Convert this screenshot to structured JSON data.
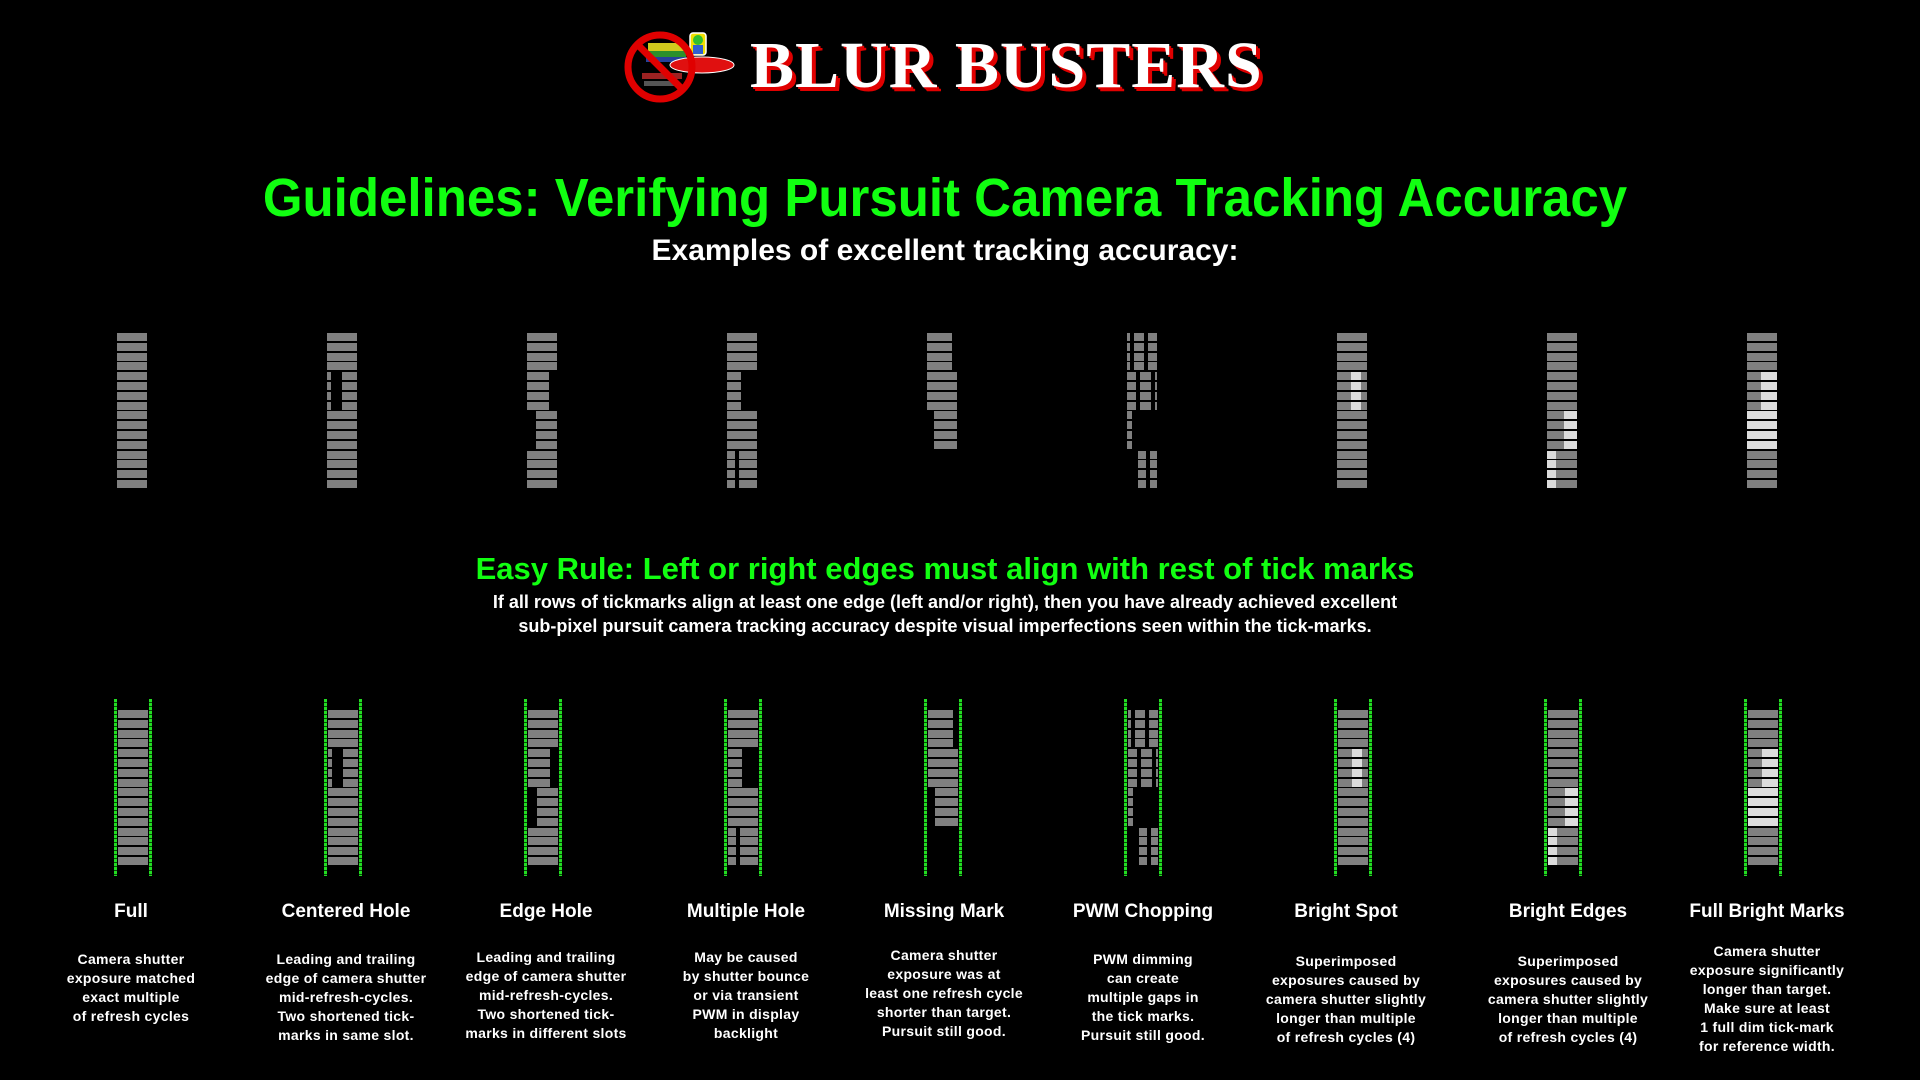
{
  "logo": {
    "text": "BLUR BUSTERS",
    "icon": "no-blur-ufo-icon"
  },
  "title": "Guidelines: Verifying Pursuit Camera Tracking Accuracy",
  "subtitle": "Examples of excellent tracking accuracy:",
  "rule": {
    "heading": "Easy Rule: Left or right edges must align with rest of tick marks",
    "lines": [
      "If all rows of tickmarks align at least one edge (left and/or right), then you have already achieved excellent",
      "sub-pixel pursuit camera tracking accuracy despite visual imperfections seen within the tick-marks."
    ]
  },
  "colors": {
    "title_green": "#11ff11",
    "tick_dim": "#808080",
    "tick_bright": "#dcdcdc",
    "guide_green": "#22dd22",
    "logo_red": "#e00000"
  },
  "tick_rows": 16,
  "tick_pattern_units": "segment ranges as fraction of full tick width [start, end, brightness]",
  "examples": [
    {
      "label": "Full",
      "description": [
        "Camera shutter",
        "exposure matched",
        "exact multiple",
        "of refresh cycles"
      ],
      "groups": [
        [
          [
            0,
            1,
            "dim"
          ]
        ],
        [
          [
            0,
            1,
            "dim"
          ]
        ],
        [
          [
            0,
            1,
            "dim"
          ]
        ],
        [
          [
            0,
            1,
            "dim"
          ]
        ]
      ]
    },
    {
      "label": "Centered Hole",
      "description": [
        "Leading and trailing",
        "edge of camera shutter",
        "mid-refresh-cycles.",
        "Two shortened tick-",
        "marks in same slot."
      ],
      "groups": [
        [
          [
            0,
            1,
            "dim"
          ]
        ],
        [
          [
            0,
            0.13,
            "dim"
          ],
          [
            0.5,
            1,
            "dim"
          ]
        ],
        [
          [
            0,
            1,
            "dim"
          ]
        ],
        [
          [
            0,
            1,
            "dim"
          ]
        ]
      ]
    },
    {
      "label": "Edge Hole",
      "description": [
        "Leading and trailing",
        "edge of camera shutter",
        "mid-refresh-cycles.",
        "Two shortened tick-",
        "marks in different slots"
      ],
      "groups": [
        [
          [
            0,
            1,
            "dim"
          ]
        ],
        [
          [
            0,
            0.73,
            "dim"
          ]
        ],
        [
          [
            0.3,
            1,
            "dim"
          ]
        ],
        [
          [
            0,
            1,
            "dim"
          ]
        ]
      ]
    },
    {
      "label": "Multiple Hole",
      "description": [
        "May be caused",
        "by shutter bounce",
        "or via transient",
        "PWM in display",
        "backlight"
      ],
      "groups": [
        [
          [
            0,
            1,
            "dim"
          ]
        ],
        [
          [
            0,
            0.47,
            "dim"
          ]
        ],
        [
          [
            0,
            1,
            "dim"
          ]
        ],
        [
          [
            0,
            0.27,
            "dim"
          ],
          [
            0.4,
            1,
            "dim"
          ]
        ]
      ]
    },
    {
      "label": "Missing Mark",
      "description": [
        "Camera shutter",
        "exposure was at",
        "least one refresh cycle",
        "shorter than target.",
        "Pursuit still good."
      ],
      "groups": [
        [
          [
            0,
            0.83,
            "dim"
          ]
        ],
        [
          [
            0,
            1,
            "dim"
          ]
        ],
        [
          [
            0.23,
            1,
            "dim"
          ]
        ],
        []
      ]
    },
    {
      "label": "PWM Chopping",
      "description": [
        "PWM dimming",
        "can create",
        "multiple gaps in",
        "the tick marks.",
        "Pursuit still good."
      ],
      "groups": [
        [
          [
            0,
            0.1,
            "dim"
          ],
          [
            0.23,
            0.57,
            "dim"
          ],
          [
            0.7,
            1,
            "dim"
          ]
        ],
        [
          [
            0,
            0.3,
            "dim"
          ],
          [
            0.43,
            0.8,
            "dim"
          ],
          [
            0.93,
            1,
            "dim"
          ]
        ],
        [
          [
            0,
            0.17,
            "dim"
          ]
        ],
        [
          [
            0.37,
            0.63,
            "dim"
          ],
          [
            0.77,
            1,
            "dim"
          ]
        ]
      ]
    },
    {
      "label": "Bright Spot",
      "description": [
        "Superimposed",
        "exposures caused by",
        "camera shutter slightly",
        "longer than multiple",
        "of refresh cycles (4)"
      ],
      "groups": [
        [
          [
            0,
            1,
            "dim"
          ]
        ],
        [
          [
            0,
            0.47,
            "dim"
          ],
          [
            0.47,
            0.8,
            "bright"
          ],
          [
            0.8,
            1,
            "dim"
          ]
        ],
        [
          [
            0,
            1,
            "dim"
          ]
        ],
        [
          [
            0,
            1,
            "dim"
          ]
        ]
      ]
    },
    {
      "label": "Bright Edges",
      "description": [
        "Superimposed",
        "exposures caused by",
        "camera shutter slightly",
        "longer than multiple",
        "of refresh cycles (4)"
      ],
      "groups": [
        [
          [
            0,
            1,
            "dim"
          ]
        ],
        [
          [
            0,
            1,
            "dim"
          ]
        ],
        [
          [
            0,
            0.57,
            "dim"
          ],
          [
            0.57,
            1,
            "bright"
          ]
        ],
        [
          [
            0,
            0.3,
            "bright"
          ],
          [
            0.3,
            1,
            "dim"
          ]
        ]
      ]
    },
    {
      "label": "Full Bright Marks",
      "description": [
        "Camera shutter",
        "exposure significantly",
        "longer than target.",
        "Make sure at least",
        "1 full dim tick-mark",
        "for reference width."
      ],
      "groups": [
        [
          [
            0,
            1,
            "dim"
          ]
        ],
        [
          [
            0,
            0.47,
            "dim"
          ],
          [
            0.47,
            1,
            "bright"
          ]
        ],
        [
          [
            0,
            1,
            "bright"
          ]
        ],
        [
          [
            0,
            1,
            "dim"
          ]
        ]
      ]
    }
  ]
}
